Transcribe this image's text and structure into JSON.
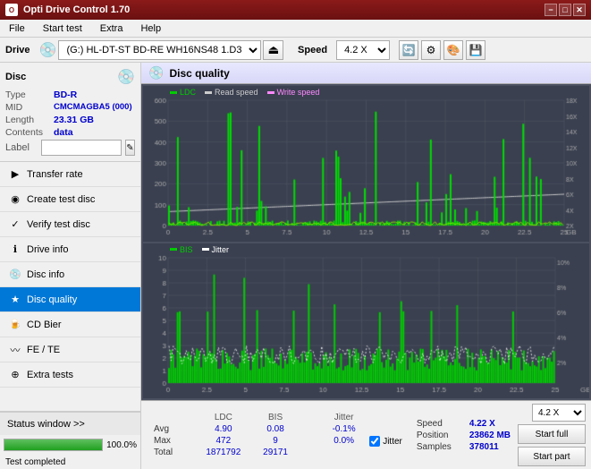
{
  "titlebar": {
    "title": "Opti Drive Control 1.70",
    "icon_text": "O",
    "minimize": "−",
    "maximize": "□",
    "close": "✕"
  },
  "menubar": {
    "items": [
      "File",
      "Start test",
      "Extra",
      "Help"
    ]
  },
  "drivebar": {
    "drive_label": "Drive",
    "drive_value": "(G:) HL-DT-ST BD-RE  WH16NS48 1.D3",
    "speed_label": "Speed",
    "speed_value": "4.2 X"
  },
  "disc": {
    "label": "Disc",
    "type_label": "Type",
    "type_value": "BD-R",
    "mid_label": "MID",
    "mid_value": "CMCMAGBA5 (000)",
    "length_label": "Length",
    "length_value": "23.31 GB",
    "contents_label": "Contents",
    "contents_value": "data",
    "label_label": "Label",
    "label_input_value": ""
  },
  "nav": {
    "items": [
      {
        "id": "transfer-rate",
        "label": "Transfer rate",
        "icon": "▶"
      },
      {
        "id": "create-test-disc",
        "label": "Create test disc",
        "icon": "◉"
      },
      {
        "id": "verify-test-disc",
        "label": "Verify test disc",
        "icon": "✓"
      },
      {
        "id": "drive-info",
        "label": "Drive info",
        "icon": "ℹ"
      },
      {
        "id": "disc-info",
        "label": "Disc info",
        "icon": "💿"
      },
      {
        "id": "disc-quality",
        "label": "Disc quality",
        "icon": "★",
        "active": true
      },
      {
        "id": "cd-bier",
        "label": "CD Bier",
        "icon": "🍺"
      },
      {
        "id": "fe-te",
        "label": "FE / TE",
        "icon": "〰"
      },
      {
        "id": "extra-tests",
        "label": "Extra tests",
        "icon": "⊕"
      }
    ]
  },
  "status": {
    "window_label": "Status window >>",
    "progress_percent": 100,
    "progress_label": "100.0%",
    "completed_text": "Test completed"
  },
  "disc_quality": {
    "title": "Disc quality",
    "legend": {
      "ldc_label": "LDC",
      "ldc_color": "#00cc00",
      "read_speed_label": "Read speed",
      "read_speed_color": "#cccccc",
      "write_speed_label": "Write speed",
      "write_speed_color": "#ff88ff",
      "bis_label": "BIS",
      "bis_color": "#00cc00",
      "jitter_label": "Jitter",
      "jitter_color": "#ffffff"
    }
  },
  "stats": {
    "col_ldc": "LDC",
    "col_bis": "BIS",
    "col_jitter_label": "Jitter",
    "jitter_checked": true,
    "row_avg": {
      "label": "Avg",
      "ldc": "4.90",
      "bis": "0.08",
      "jitter": "-0.1%"
    },
    "row_max": {
      "label": "Max",
      "ldc": "472",
      "bis": "9",
      "jitter": "0.0%"
    },
    "row_total": {
      "label": "Total",
      "ldc": "1871792",
      "bis": "29171"
    },
    "speed_label": "Speed",
    "speed_value": "4.22 X",
    "speed_dropdown": "4.2 X",
    "position_label": "Position",
    "position_value": "23862 MB",
    "samples_label": "Samples",
    "samples_value": "378011",
    "start_full_btn": "Start full",
    "start_part_btn": "Start part"
  }
}
